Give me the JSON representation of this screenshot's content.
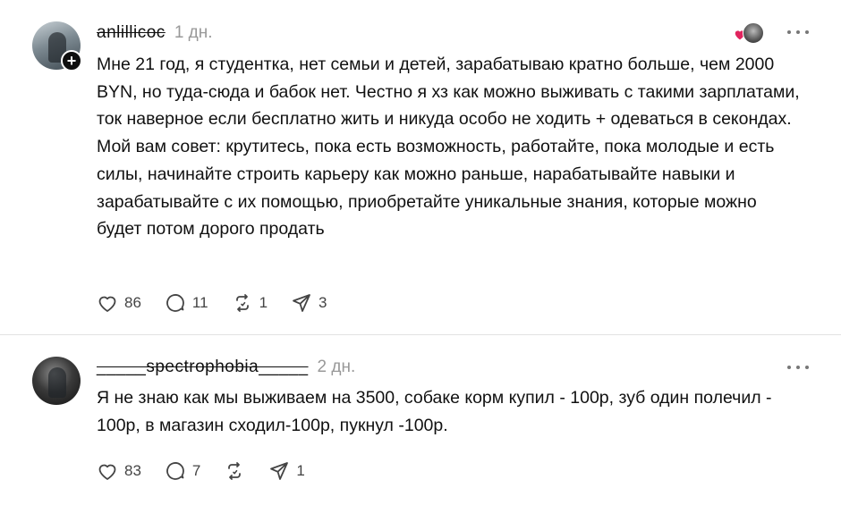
{
  "posts": [
    {
      "username": "anlillicoc",
      "time": "1 дн.",
      "text": "Мне 21 год, я студентка, нет семьи и детей, зарабатываю кратно больше, чем 2000 BYN, но туда-сюда и бабок нет. Честно я хз как можно выживать с такими зарплатами, ток наверное если бесплатно жить и никуда особо не ходить + одеваться в секондах. Мой вам совет: крутитесь, пока есть возможность, работайте, пока молодые и есть силы, начинайте строить карьеру как можно раньше, нарабатывайте навыки и зарабатывайте с их помощью, приобретайте уникальные знания, которые можно будет потом дорого продать",
      "likes": "86",
      "replies": "11",
      "reposts": "1",
      "shares": "3",
      "has_reaction_stack": true
    },
    {
      "username": "_____spectrophobia_____",
      "time": "2 дн.",
      "text": "Я не знаю как мы выживаем на 3500, собаке корм купил - 100р, зуб один полечил - 100р, в магазин сходил-100р, пукнул -100р.",
      "likes": "83",
      "replies": "7",
      "reposts": "",
      "shares": "1",
      "has_reaction_stack": false
    }
  ],
  "icons": {
    "follow": "+",
    "like": "heart-icon",
    "reply": "comment-bubble-icon",
    "repost": "repost-icon",
    "share": "send-icon",
    "more": "more-icon"
  },
  "colors": {
    "text": "#0f0f0f",
    "muted": "#999999",
    "icon": "#444444",
    "reaction_heart": "#e0245e"
  }
}
